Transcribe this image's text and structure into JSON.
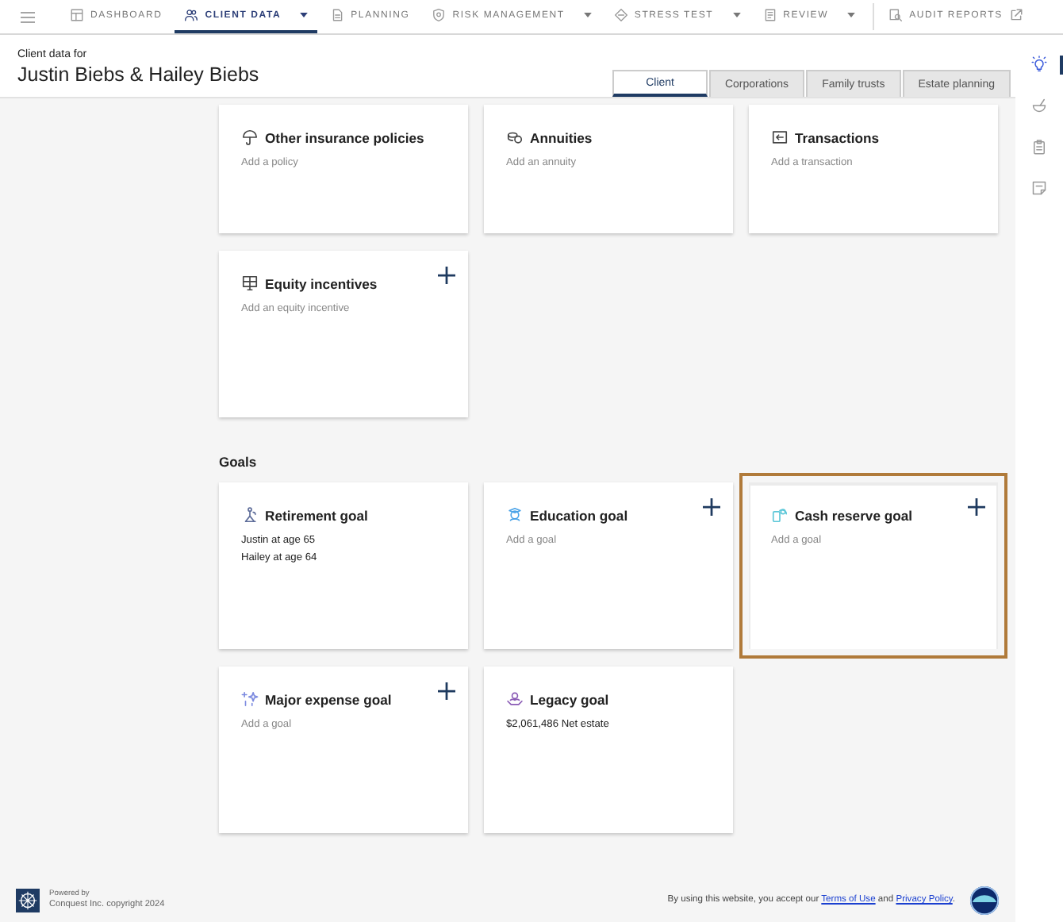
{
  "nav": [
    {
      "label": "DASHBOARD",
      "kind": "dashboard",
      "selected": false,
      "dropdown": false
    },
    {
      "label": "CLIENT DATA",
      "kind": "people",
      "selected": true,
      "dropdown": true
    },
    {
      "label": "PLANNING",
      "kind": "planning",
      "selected": false,
      "dropdown": false
    },
    {
      "label": "RISK MANAGEMENT",
      "kind": "shield",
      "selected": false,
      "dropdown": true
    },
    {
      "label": "STRESS TEST",
      "kind": "diamond",
      "selected": false,
      "dropdown": true
    },
    {
      "label": "REVIEW",
      "kind": "review",
      "selected": false,
      "dropdown": true
    },
    {
      "label": "AUDIT REPORTS",
      "kind": "audit",
      "selected": false,
      "dropdown": false,
      "external": true
    }
  ],
  "header": {
    "caption": "Client data for",
    "client_name": "Justin Biebs & Hailey Biebs"
  },
  "tabs": [
    {
      "label": "Client",
      "selected": true
    },
    {
      "label": "Corporations",
      "selected": false
    },
    {
      "label": "Family trusts",
      "selected": false
    },
    {
      "label": "Estate planning",
      "selected": false
    }
  ],
  "sections": [
    {
      "cards": [
        {
          "title": "Other insurance policies",
          "kind": "umbrella",
          "add_button": false,
          "highlighted": false,
          "lines": [
            {
              "text": "Add a policy",
              "muted": true
            }
          ]
        },
        {
          "title": "Annuities",
          "kind": "coins",
          "add_button": false,
          "highlighted": false,
          "lines": [
            {
              "text": "Add an annuity",
              "muted": true
            }
          ]
        },
        {
          "title": "Transactions",
          "kind": "transaction",
          "add_button": false,
          "highlighted": false,
          "lines": [
            {
              "text": "Add a transaction",
              "muted": true
            }
          ]
        },
        {
          "title": "Equity incentives",
          "kind": "equity",
          "add_button": true,
          "highlighted": false,
          "lines": [
            {
              "text": "Add an equity incentive",
              "muted": true
            }
          ]
        }
      ]
    },
    {
      "heading": "Goals",
      "cards": [
        {
          "title": "Retirement goal",
          "kind": "retirement",
          "add_button": false,
          "highlighted": false,
          "lines": [
            {
              "text": "Justin at age 65",
              "muted": false
            },
            {
              "text": "Hailey at age 64",
              "muted": false
            }
          ]
        },
        {
          "title": "Education goal",
          "kind": "education",
          "add_button": true,
          "highlighted": false,
          "lines": [
            {
              "text": "Add a goal",
              "muted": true
            }
          ]
        },
        {
          "title": "Cash reserve goal",
          "kind": "cash",
          "add_button": true,
          "highlighted": true,
          "lines": [
            {
              "text": "Add a goal",
              "muted": true
            }
          ]
        },
        {
          "title": "Major expense goal",
          "kind": "expense",
          "add_button": true,
          "highlighted": false,
          "lines": [
            {
              "text": "Add a goal",
              "muted": true
            }
          ]
        },
        {
          "title": "Legacy goal",
          "kind": "legacy",
          "add_button": false,
          "highlighted": false,
          "lines": [
            {
              "text": "$2,061,486 Net estate",
              "muted": false
            }
          ]
        }
      ]
    }
  ],
  "side_panel": [
    {
      "kind": "lightbulb",
      "selected": true
    },
    {
      "kind": "bowl",
      "selected": false
    },
    {
      "kind": "clipboard",
      "selected": false
    },
    {
      "kind": "note",
      "selected": false
    }
  ],
  "footer": {
    "powered_by": "Powered by",
    "copyright": "Conquest Inc. copyright 2024",
    "notice_start": "By using this website, you accept our ",
    "terms_link": "Terms of Use",
    "notice_middle": " and ",
    "privacy_link": "Privacy Policy",
    "notice_end": "."
  }
}
